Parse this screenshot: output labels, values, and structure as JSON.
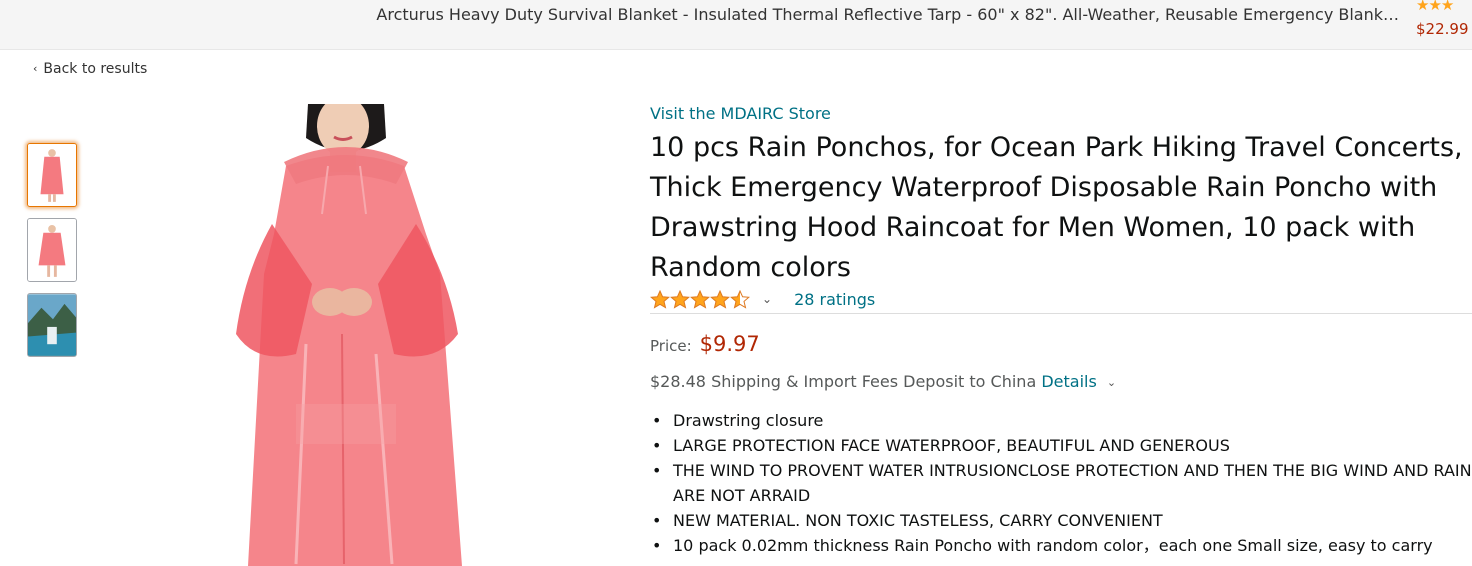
{
  "ad_bar": {
    "title": "Arcturus Heavy Duty Survival Blanket - Insulated Thermal Reflective Tarp - 60\" x 82\". All-Weather, Reusable Emergency Blank…",
    "stars": "★★★",
    "price": "$22.99"
  },
  "nav": {
    "back_label": "Back to results",
    "back_icon": "‹"
  },
  "thumbnails": [
    {
      "label": "thumbnail-1",
      "active": true
    },
    {
      "label": "thumbnail-2",
      "active": false
    },
    {
      "label": "thumbnail-3",
      "active": false
    }
  ],
  "product": {
    "store_link": "Visit the MDAIRC Store",
    "title": "10 pcs Rain Ponchos, for Ocean Park Hiking Travel Concerts, Thick Emergency Waterproof Disposable Rain Poncho with Drawstring Hood Raincoat for Men Women, 10 pack with Random colors",
    "rating_value": 4.5,
    "ratings_label": "28 ratings",
    "price_label": "Price:",
    "price": "$9.97",
    "shipping_text": "$28.48 Shipping & Import Fees Deposit to China",
    "details_label": "Details",
    "bullets": [
      "Drawstring closure",
      "LARGE PROTECTION FACE WATERPROOF, BEAUTIFUL AND GENEROUS",
      "THE WIND TO PROVENT WATER INTRUSIONCLOSE PROTECTION AND THEN THE BIG WIND AND RAIN ARE NOT ARRAID",
      "NEW MATERIAL. NON TOXIC TASTELESS, CARRY CONVENIENT",
      "10 pack 0.02mm thickness Rain Poncho with random color，each one Small size, easy to carry"
    ]
  },
  "colors": {
    "link": "#007185",
    "price": "#b12704",
    "star": "#ffa41c",
    "thumb_active_border": "#e77600",
    "poncho": "#f2636a"
  }
}
